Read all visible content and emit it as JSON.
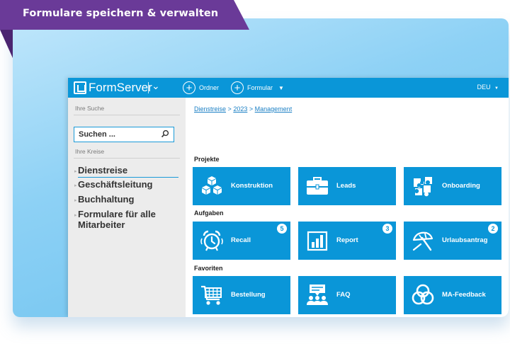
{
  "banner": {
    "title": "Formulare speichern & verwalten"
  },
  "topbar": {
    "app_name": "FormServer",
    "folder_button": "Ordner",
    "form_button": "Formular",
    "language": "DEU"
  },
  "sidebar": {
    "search_label": "Ihre Suche",
    "search_placeholder": "Suchen ...",
    "circles_label": "Ihre Kreise",
    "circles": [
      {
        "label": "Dienstreise"
      },
      {
        "label": "Geschäftsleitung"
      },
      {
        "label": "Buchhaltung"
      },
      {
        "label": "Formulare für alle"
      },
      {
        "label": "Mitarbeiter"
      }
    ]
  },
  "breadcrumb": {
    "items": [
      "Dienstreise",
      "2023",
      "Management"
    ],
    "separator": ">"
  },
  "sections": {
    "projects": {
      "title": "Projekte",
      "tiles": [
        {
          "label": "Konstruktion",
          "icon": "cubes-icon"
        },
        {
          "label": "Leads",
          "icon": "briefcase-icon"
        },
        {
          "label": "Onboarding",
          "icon": "puzzle-icon"
        }
      ]
    },
    "tasks": {
      "title": "Aufgaben",
      "tiles": [
        {
          "label": "Recall",
          "icon": "alarm-clock-icon",
          "badge": "5"
        },
        {
          "label": "Report",
          "icon": "bar-chart-icon",
          "badge": "3"
        },
        {
          "label": "Urlaubsantrag",
          "icon": "beach-umbrella-icon",
          "badge": "2"
        }
      ]
    },
    "favorites": {
      "title": "Favoriten",
      "tiles": [
        {
          "label": "Bestellung",
          "icon": "shopping-cart-icon"
        },
        {
          "label": "FAQ",
          "icon": "group-chat-icon"
        },
        {
          "label": "MA-Feedback",
          "icon": "venn-diagram-icon"
        }
      ]
    }
  },
  "colors": {
    "accent": "#0a96d8",
    "banner": "#6a3a98",
    "sidebar": "#ececec"
  }
}
